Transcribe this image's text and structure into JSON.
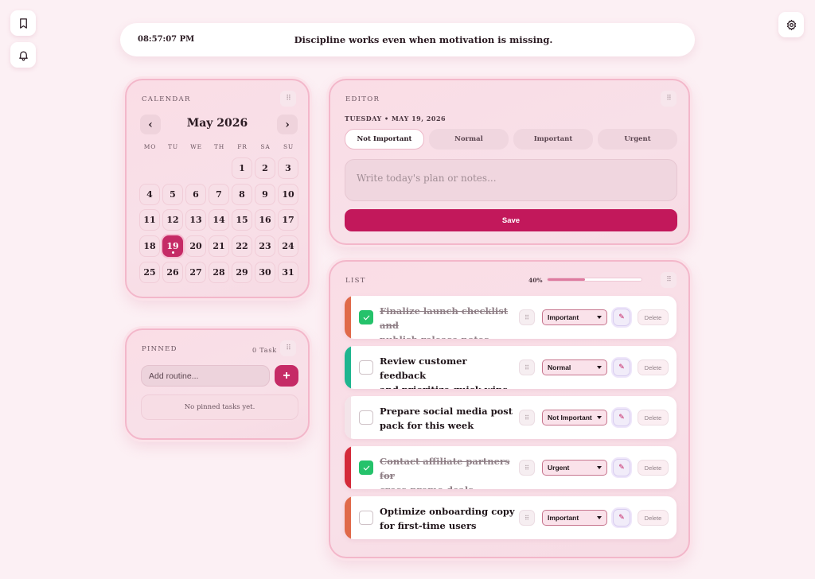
{
  "topbar": {
    "time": "08:57:07 PM",
    "quote": "Discipline works even when motivation is missing."
  },
  "icons": {
    "bookmark": "bookmark-icon",
    "bell": "bell-icon",
    "settings": "gear-icon",
    "grip": "⠿"
  },
  "calendar": {
    "title": "CALENDAR",
    "month": "May 2026",
    "prev": "‹",
    "next": "›",
    "weekdays": [
      "MO",
      "TU",
      "WE",
      "TH",
      "FR",
      "SA",
      "SU"
    ],
    "days": [
      "1",
      "2",
      "3",
      "4",
      "5",
      "6",
      "7",
      "8",
      "9",
      "10",
      "11",
      "12",
      "13",
      "14",
      "15",
      "16",
      "17",
      "18",
      "19",
      "20",
      "21",
      "22",
      "23",
      "24",
      "25",
      "26",
      "27",
      "28",
      "29",
      "30",
      "31"
    ],
    "selected_day": "19"
  },
  "pinned": {
    "title": "PINNED",
    "count": "0 Task",
    "placeholder": "Add routine...",
    "add": "+",
    "empty": "No pinned tasks yet."
  },
  "editor": {
    "title": "EDITOR",
    "date": "TUESDAY • MAY 19, 2026",
    "priorities": [
      "Not Important",
      "Normal",
      "Important",
      "Urgent"
    ],
    "active_priority": "Not Important",
    "placeholder": "Write today's plan or notes...",
    "save": "Save"
  },
  "list": {
    "title": "LIST",
    "progress_label": "40%",
    "progress": 0.4,
    "edit_glyph": "✎",
    "delete_label": "Delete",
    "tasks": [
      {
        "line1": "Finalize launch checklist and",
        "line2": "publish release notes",
        "done": true,
        "priority": "Important",
        "color": "#e06a4a"
      },
      {
        "line1": "Review customer feedback",
        "line2": "and prioritize quick wins",
        "done": false,
        "priority": "Normal",
        "color": "#1fb58f"
      },
      {
        "line1": "Prepare social media post",
        "line2": "pack for this week",
        "done": false,
        "priority": "Not Important",
        "color": "#f3e4e9"
      },
      {
        "line1": "Contact affiliate partners for",
        "line2": "cross-promo deals",
        "done": true,
        "priority": "Urgent",
        "color": "#d42b3a"
      },
      {
        "line1": "Optimize onboarding copy",
        "line2": "for first-time users",
        "done": false,
        "priority": "Important",
        "color": "#e06a4a"
      }
    ]
  },
  "colors": {
    "accent": "#c2185b",
    "check": "#25c26b",
    "background": "#fcf0f4"
  }
}
